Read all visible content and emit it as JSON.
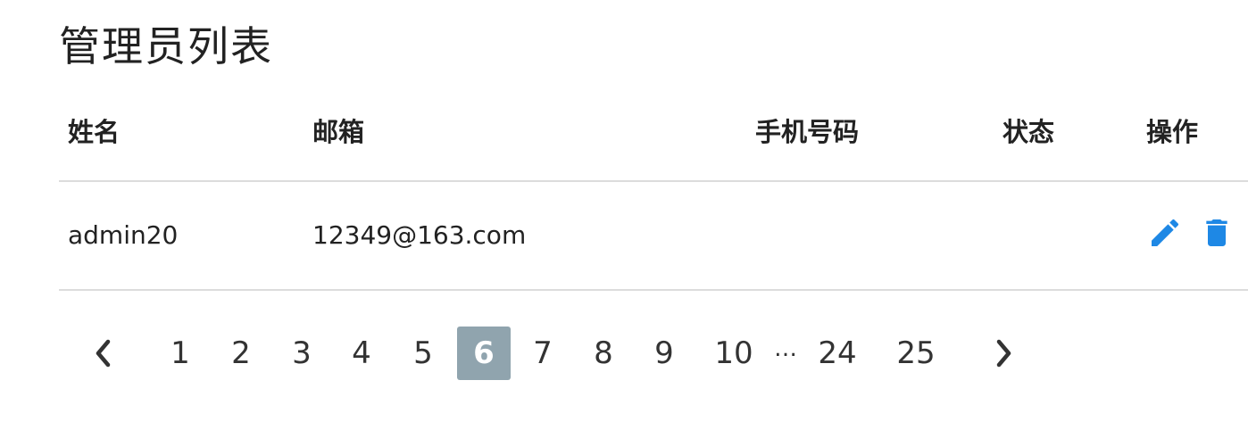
{
  "page_title": "管理员列表",
  "table": {
    "headers": {
      "name": "姓名",
      "email": "邮箱",
      "phone": "手机号码",
      "status": "状态",
      "actions": "操作"
    },
    "rows": [
      {
        "name": "admin20",
        "email": "12349@163.com",
        "phone": "",
        "status": ""
      }
    ],
    "action_icons": {
      "edit": "pencil-icon",
      "delete": "trash-icon"
    }
  },
  "pagination": {
    "prev_icon": "chevron-left-icon",
    "next_icon": "chevron-right-icon",
    "pages": [
      "1",
      "2",
      "3",
      "4",
      "5",
      "6",
      "7",
      "8",
      "9",
      "10",
      "…",
      "24",
      "25"
    ],
    "current": "6"
  },
  "colors": {
    "accent": "#1e88e5",
    "active_page_bg": "#90a4ae",
    "divider": "#dcdcdc"
  }
}
